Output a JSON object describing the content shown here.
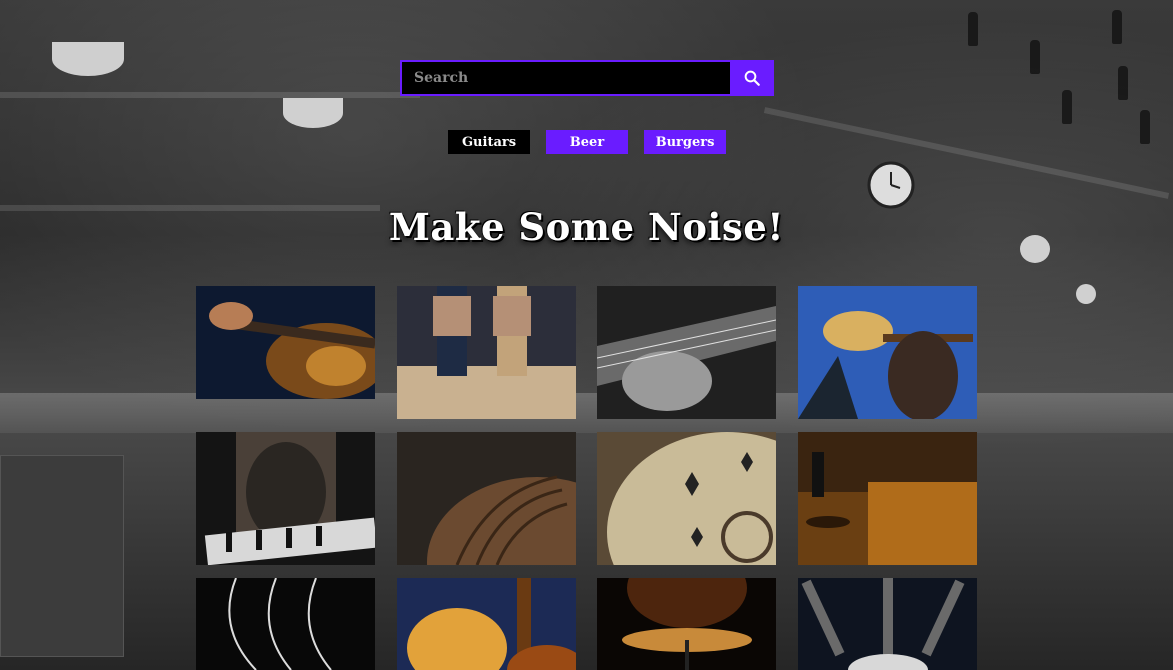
{
  "search": {
    "placeholder": "Search",
    "value": ""
  },
  "tabs": [
    {
      "label": "Guitars",
      "active": true
    },
    {
      "label": "Beer",
      "active": false
    },
    {
      "label": "Burgers",
      "active": false
    }
  ],
  "headline": "Make Some Noise!",
  "colors": {
    "accent": "#6a1cff",
    "active_tab": "#000000",
    "text": "#ffffff"
  },
  "icons": {
    "search": "search-icon"
  },
  "gallery": {
    "rows": 3,
    "columns": 4,
    "images": [
      {
        "name": "gallery-image-guitar-strings-closeup"
      },
      {
        "name": "gallery-image-two-guitarists-walking"
      },
      {
        "name": "gallery-image-hand-on-fretboard"
      },
      {
        "name": "gallery-image-man-holding-guitar-sky"
      },
      {
        "name": "gallery-image-guitar-player-blurred"
      },
      {
        "name": "gallery-image-lute-back"
      },
      {
        "name": "gallery-image-oud-soundboard"
      },
      {
        "name": "gallery-image-man-with-guitar-case-night"
      },
      {
        "name": "gallery-image-black-guitar-strings"
      },
      {
        "name": "gallery-image-guitars-orange-light"
      },
      {
        "name": "gallery-image-cymbal-stage-light"
      },
      {
        "name": "gallery-image-guitar-necks-crowd"
      }
    ]
  }
}
